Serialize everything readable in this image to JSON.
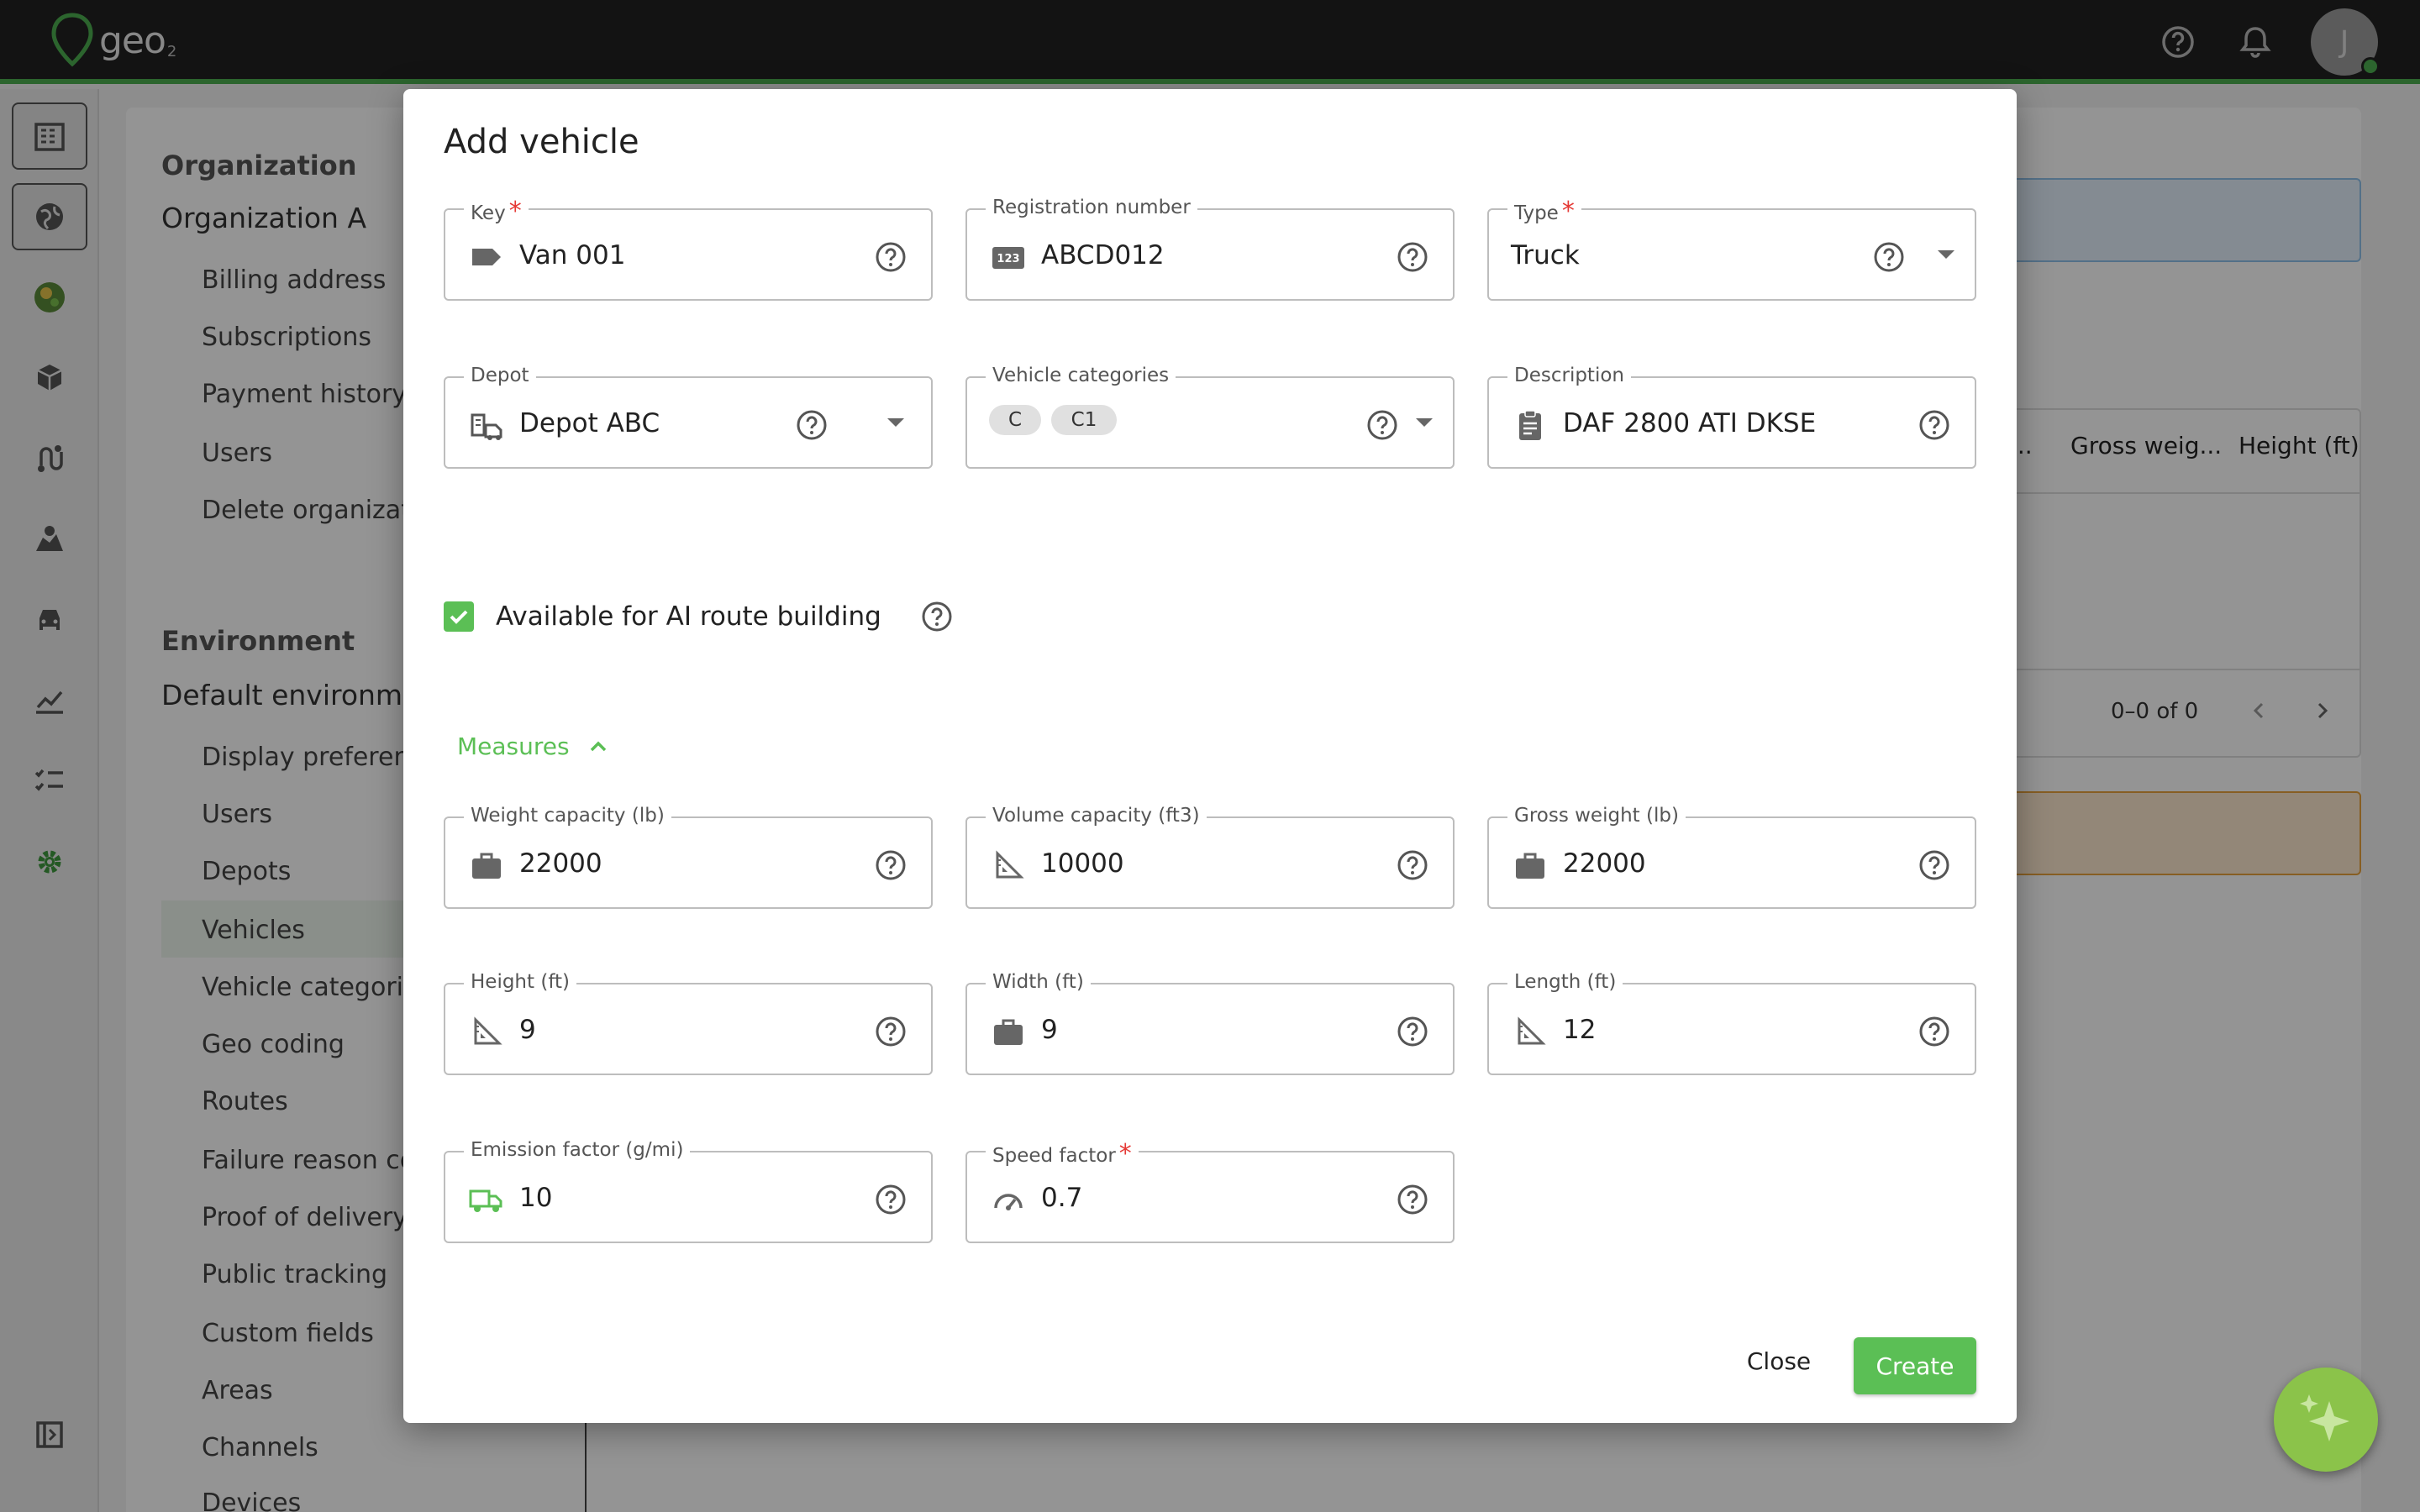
{
  "app": {
    "logo_text": "geo",
    "logo_sub": "2",
    "avatar_initial": "J"
  },
  "settings_nav": {
    "org_heading": "Organization",
    "org_name": "Organization A",
    "org_items": [
      "Billing address",
      "Subscriptions",
      "Payment history",
      "Users",
      "Delete organizati"
    ],
    "env_heading": "Environment",
    "env_name": "Default environmen",
    "env_items": [
      "Display preferenc",
      "Users",
      "Depots",
      "Vehicles",
      "Vehicle categorie",
      "Geo coding",
      "Routes",
      "Failure reason co",
      "Proof of delivery",
      "Public tracking",
      "Custom fields",
      "Areas",
      "Channels",
      "Devices"
    ],
    "selected_item": "Vehicles"
  },
  "background_table": {
    "columns": [
      "...",
      "Gross weig...",
      "Height (ft)"
    ],
    "pager": "0–0 of 0"
  },
  "dialog": {
    "title": "Add vehicle",
    "fields": {
      "key": {
        "label": "Key",
        "value": "Van 001",
        "required": "*"
      },
      "registration": {
        "label": "Registration number",
        "value": "ABCD012"
      },
      "type": {
        "label": "Type",
        "value": "Truck",
        "required": "*"
      },
      "depot": {
        "label": "Depot",
        "value": "Depot ABC"
      },
      "categories": {
        "label": "Vehicle categories",
        "chips": [
          "C",
          "C1"
        ]
      },
      "description": {
        "label": "Description",
        "value": "DAF 2800 ATI DKSE"
      },
      "weight_capacity": {
        "label": "Weight capacity (lb)",
        "value": "22000"
      },
      "volume_capacity": {
        "label": "Volume capacity (ft3)",
        "value": "10000"
      },
      "gross_weight": {
        "label": "Gross weight (lb)",
        "value": "22000"
      },
      "height": {
        "label": "Height (ft)",
        "value": "9"
      },
      "width": {
        "label": "Width (ft)",
        "value": "9"
      },
      "length": {
        "label": "Length (ft)",
        "value": "12"
      },
      "emission": {
        "label": "Emission factor (g/mi)",
        "value": "10"
      },
      "speed": {
        "label": "Speed factor",
        "value": "0.7",
        "required": "*"
      }
    },
    "ai_checkbox": {
      "label": "Available for AI route building",
      "checked": true
    },
    "measures_toggle": "Measures",
    "buttons": {
      "close": "Close",
      "create": "Create"
    }
  },
  "colors": {
    "accent": "#5bbf55",
    "required": "#e53935",
    "topbar": "#212121"
  }
}
